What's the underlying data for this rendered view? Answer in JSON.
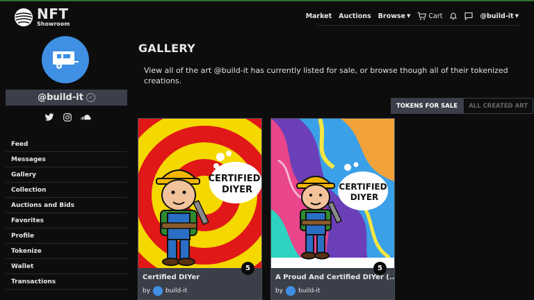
{
  "brand": {
    "name": "NFT",
    "sub": "Showroom"
  },
  "topnav": {
    "market": "Market",
    "auctions": "Auctions",
    "browse": "Browse",
    "cart": "Cart",
    "user": "@build-it"
  },
  "profile": {
    "handle": "@build-it"
  },
  "sidebar": {
    "items": [
      {
        "label": "Feed"
      },
      {
        "label": "Messages"
      },
      {
        "label": "Gallery"
      },
      {
        "label": "Collection"
      },
      {
        "label": "Auctions and Bids"
      },
      {
        "label": "Favorites"
      },
      {
        "label": "Profile"
      },
      {
        "label": "Tokenize"
      },
      {
        "label": "Wallet"
      },
      {
        "label": "Transactions"
      }
    ]
  },
  "main": {
    "title": "GALLERY",
    "description": "View all of the art @build-it has currently listed for sale, or browse though all of their tokenized creations.",
    "tabs": {
      "for_sale": "TOKENS FOR SALE",
      "all_created": "ALL CREATED ART"
    }
  },
  "cards": [
    {
      "title": "Certified DIYer",
      "by": "by",
      "creator": "build-it",
      "edition_count": "5",
      "art_text": "CERTIFIED DIYER"
    },
    {
      "title": "A Proud And Certified DIYer (...",
      "by": "by",
      "creator": "build-it",
      "edition_count": "5",
      "art_text": "CERTIFIED DIYER"
    }
  ],
  "colors": {
    "accent": "#3f8fe4",
    "panel": "#3a3f4a",
    "background": "#0d0d0d"
  }
}
